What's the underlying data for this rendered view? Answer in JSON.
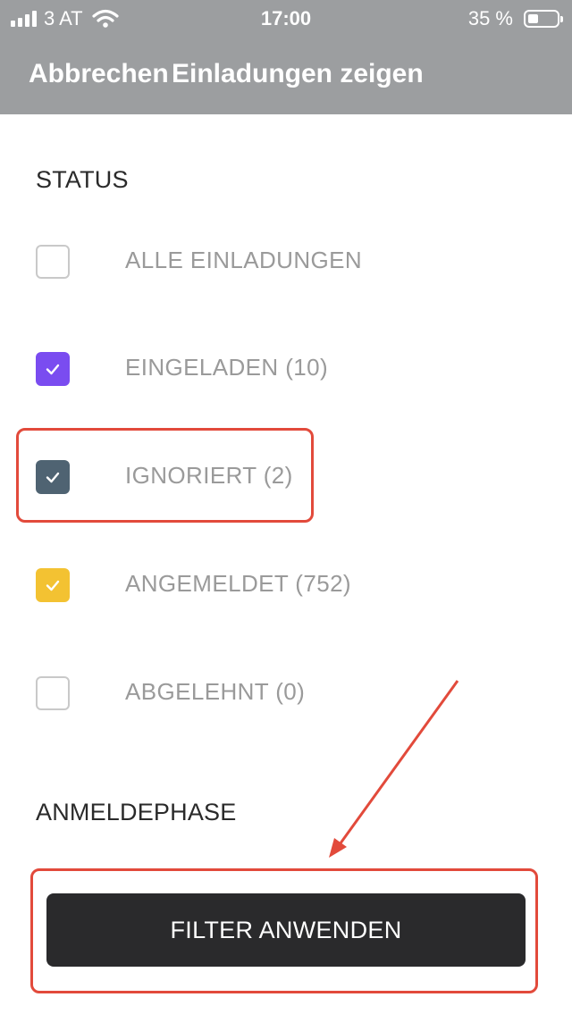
{
  "status_bar": {
    "carrier": "3 AT",
    "time": "17:00",
    "battery_percent": "35 %",
    "battery_level": 0.35,
    "signal_bars": 4,
    "icons": [
      "signal-icon",
      "wifi-icon",
      "battery-icon"
    ]
  },
  "header": {
    "cancel_label": "Abbrechen",
    "title": "Einladungen zeigen"
  },
  "status_section": {
    "label": "STATUS",
    "items": [
      {
        "label": "ALLE EINLADUNGEN",
        "checked": false,
        "color": "#ffffff"
      },
      {
        "label": "EINGELADEN (10)",
        "checked": true,
        "color": "#7a4cf0"
      },
      {
        "label": "IGNORIERT (2)",
        "checked": true,
        "color": "#4f6372"
      },
      {
        "label": "ANGEMELDET (752)",
        "checked": true,
        "color": "#f3c232"
      },
      {
        "label": "ABGELEHNT (0)",
        "checked": false,
        "color": "#ffffff"
      }
    ]
  },
  "phase_section": {
    "label": "ANMELDEPHASE"
  },
  "apply_button": {
    "label": "FILTER ANWENDEN"
  },
  "colors": {
    "header_bg": "#9c9ea0",
    "annotation_red": "#e24a3b",
    "button_bg": "#2a2a2c"
  }
}
